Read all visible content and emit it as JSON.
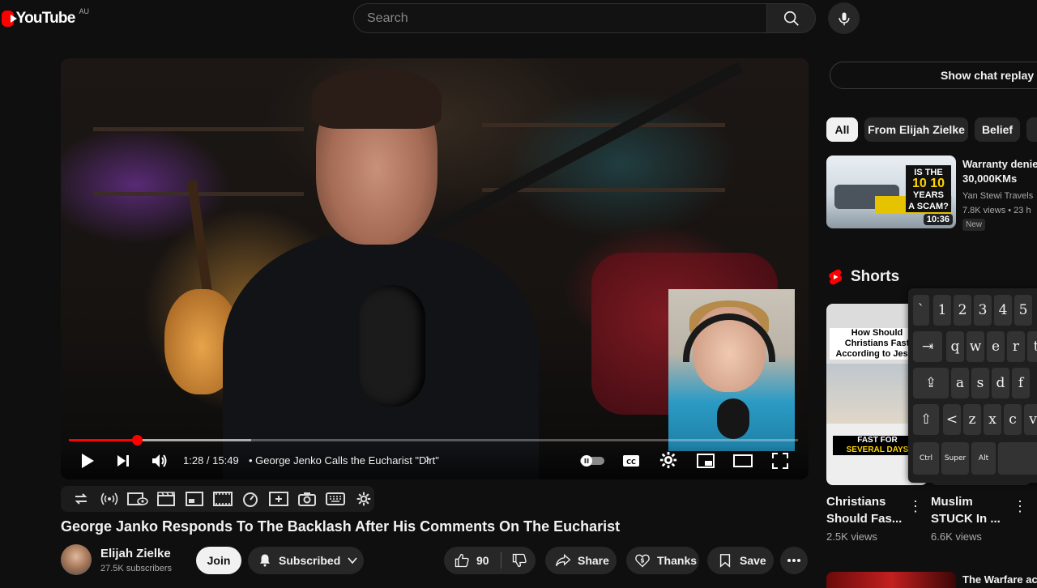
{
  "header": {
    "logo_text": "YouTube",
    "region": "AU",
    "search_placeholder": "Search"
  },
  "player": {
    "time": "1:28 / 15:49",
    "chapter": "• George Jenko Calls the Eucharist \"Dirt\"",
    "progress_fraction": 0.093,
    "buffered_fraction": 0.25,
    "accent_color": "#ff0000"
  },
  "video": {
    "title": "George Janko Responds To The Backlash After His Comments On The Eucharist",
    "channel": "Elijah Zielke",
    "subscribers": "27.5K subscribers",
    "join_label": "Join",
    "subscribed_label": "Subscribed",
    "likes": "90",
    "share_label": "Share",
    "thanks_label": "Thanks",
    "save_label": "Save"
  },
  "sidebar": {
    "chat_replay_label": "Show chat replay",
    "chips": [
      "All",
      "From Elijah Zielke",
      "Belief"
    ],
    "recommended": {
      "title_line1": "Warranty denied",
      "title_line2": "30,000KMs",
      "channel": "Yan Stewi Travels",
      "meta": "7.8K views • 23 h",
      "badge": "New",
      "duration": "10:36",
      "thumb_line1": "IS THE",
      "thumb_ten": "10 10",
      "thumb_line2": "YEARS",
      "thumb_line3": "A SCAM?"
    },
    "shorts_label": "Shorts",
    "shorts": [
      {
        "title_line1": "Christians",
        "title_line2": "Should Fas...",
        "views": "2.5K views",
        "thumb_text": "How Should Christians Fast According to Jesus",
        "thumb_caption_1": "FAST FOR",
        "thumb_caption_2": "SEVERAL DAYS"
      },
      {
        "title_line1": "Muslim",
        "title_line2": "STUCK In ...",
        "views": "6.6K views"
      }
    ],
    "next_title": "The Warfare ac"
  },
  "keyboard": {
    "row1": [
      "`",
      "1",
      "2",
      "3",
      "4",
      "5"
    ],
    "row2": [
      "⇥",
      "q",
      "w",
      "e",
      "r",
      "t"
    ],
    "row3": [
      "⇪",
      "a",
      "s",
      "d",
      "f"
    ],
    "row4": [
      "⇧",
      "<",
      "z",
      "x",
      "c",
      "v"
    ],
    "row5": [
      "Ctrl",
      "Super",
      "Alt"
    ]
  }
}
